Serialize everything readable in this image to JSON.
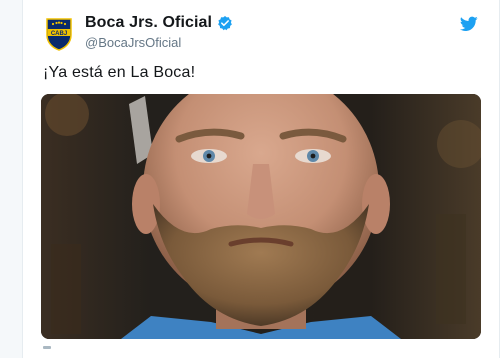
{
  "tweet": {
    "display_name": "Boca Jrs. Oficial",
    "handle": "@BocaJrsOficial",
    "text": "¡Ya está en La Boca!",
    "avatar_monogram": "CABJ",
    "media_description": "photo",
    "icons": {
      "verified": "verified-badge-icon",
      "platform": "twitter-bird-icon"
    }
  },
  "colors": {
    "accent": "#1da1f2",
    "name_text": "#14171a",
    "handle_text": "#657786",
    "club_blue": "#0a2a6b",
    "club_gold": "#f2c200"
  }
}
